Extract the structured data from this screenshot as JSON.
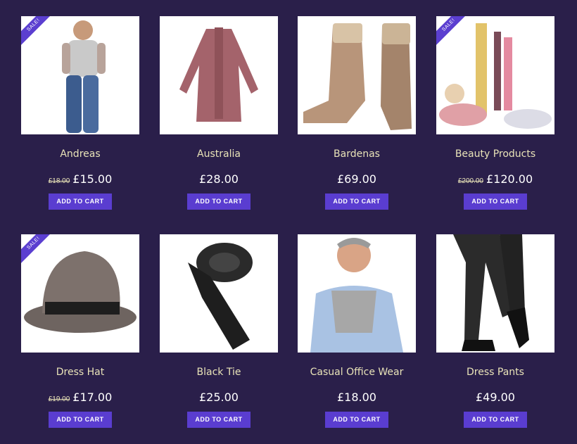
{
  "sale_badge": "SALE!",
  "cart_label": "ADD TO CART",
  "products": [
    {
      "name": "Andreas",
      "old_price": "£18.00",
      "price": "£15.00",
      "sale": true
    },
    {
      "name": "Australia",
      "old_price": "",
      "price": "£28.00",
      "sale": false
    },
    {
      "name": "Bardenas",
      "old_price": "",
      "price": "£69.00",
      "sale": false
    },
    {
      "name": "Beauty Products",
      "old_price": "£200.00",
      "price": "£120.00",
      "sale": true
    },
    {
      "name": "Dress Hat",
      "old_price": "£19.00",
      "price": "£17.00",
      "sale": true
    },
    {
      "name": "Black Tie",
      "old_price": "",
      "price": "£25.00",
      "sale": false
    },
    {
      "name": "Casual Office Wear",
      "old_price": "",
      "price": "£18.00",
      "sale": false
    },
    {
      "name": "Dress Pants",
      "old_price": "",
      "price": "£49.00",
      "sale": false
    }
  ]
}
